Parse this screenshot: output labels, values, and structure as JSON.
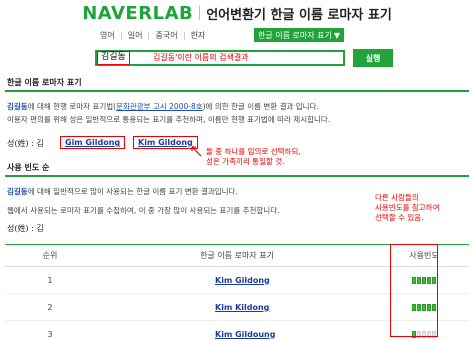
{
  "header": {
    "logo_naver": "NAVER",
    "logo_lab": "LAB",
    "service_title": "언어변환기",
    "service_subtitle": "한글 이름 로마자 표기"
  },
  "menu": {
    "items": [
      "영어",
      "일어",
      "중국어",
      "한자"
    ],
    "dropdown_label": "한글 이름 로마자 표기",
    "dropdown_arrow": "▼"
  },
  "search": {
    "query": "김길동",
    "hint": "김길동'이란 이름의 검색결과",
    "submit_label": "실행"
  },
  "section1": {
    "title": "한글 이름 로마자 표기",
    "desc_name": "김길동",
    "desc_pre": "에 대해 현행 로마자 표기법(",
    "desc_link": "문화관광부 고시 2000-8호",
    "desc_post": ")에 의한 한글 이름 변환 결과 입니다.",
    "desc2": "이용자 편의를 위해 성은 일반적으로 통용되는 표기를 추천하며, 이름만 현행 표기법에 따라 제시합니다.",
    "surname_label": "성(姓) : 김",
    "results": [
      "Gim Gildong",
      "Kim Gildong"
    ],
    "note_line1": "둘 중 하나를 임의로 선택하되,",
    "note_line2": "성은 가족끼리 통일할 것."
  },
  "section2": {
    "title": "사용 빈도 순",
    "desc_name": "김길동",
    "desc1_post": "에 대해 일반적으로 많이 사용되는 한글 이름 표기 변환 결과입니다.",
    "desc2": "웹에서 사용되는 로마자 표기를 수집하여, 이 중 가장 많이 사용되는 표기를 추천합니다.",
    "surname_label": "성(姓) : 김",
    "note_line1": "다른 사람들의",
    "note_line2": "사용빈도를 참고하여",
    "note_line3": "선택할 수 있음.",
    "table": {
      "col_rank": "순위",
      "col_name": "한글 이름 로마자 표기",
      "col_freq": "사용빈도",
      "rows": [
        {
          "rank": "1",
          "name": "Kim Gildong",
          "freq": 5
        },
        {
          "rank": "2",
          "name": "Kim Kildong",
          "freq": 5
        },
        {
          "rank": "3",
          "name": "Kim Gildoung",
          "freq": 1
        }
      ]
    }
  },
  "colors": {
    "accent": "#1fa33a",
    "link": "#1a3c9e",
    "annotation": "#e00000"
  }
}
